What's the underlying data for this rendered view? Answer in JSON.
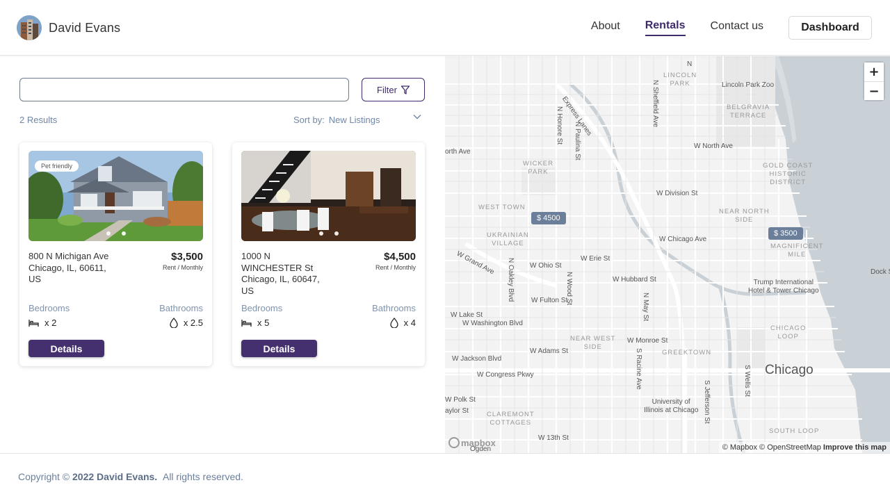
{
  "brand": {
    "name": "David Evans"
  },
  "nav": {
    "items": [
      {
        "label": "About",
        "active": false
      },
      {
        "label": "Rentals",
        "active": true
      },
      {
        "label": "Contact us",
        "active": false
      }
    ],
    "dashboard_label": "Dashboard"
  },
  "search": {
    "value": "",
    "placeholder": ""
  },
  "filter": {
    "label": "Filter",
    "icon": "filter-funnel-icon"
  },
  "results": {
    "text": "2 Results"
  },
  "sort": {
    "label": "Sort by:",
    "value": "New Listings",
    "icon": "chevron-down-icon"
  },
  "listings": [
    {
      "badge": "Pet friendly",
      "address_line1": "800 N Michigan Ave",
      "address_line2": "Chicago, IL, 60611,",
      "address_line3": "US",
      "price": "$3,500",
      "price_period": "Rent / Monthly",
      "bedrooms_label": "Bedrooms",
      "bathrooms_label": "Bathrooms",
      "bedrooms": "x 2",
      "bathrooms": "x 2.5",
      "details_label": "Details"
    },
    {
      "badge": "",
      "address_line1": "1000 N",
      "address_line2": "WINCHESTER St",
      "address_line3": "Chicago, IL, 60647,",
      "address_line4": "US",
      "price": "$4,500",
      "price_period": "Rent / Monthly",
      "bedrooms_label": "Bedrooms",
      "bathrooms_label": "Bathrooms",
      "bedrooms": "x 5",
      "bathrooms": "x 4",
      "details_label": "Details"
    }
  ],
  "map": {
    "markers": [
      "$ 4500",
      "$ 3500"
    ],
    "zoom_in": "+",
    "zoom_out": "−",
    "city_label": "Chicago",
    "logo_text": "mapbox",
    "attribution": "© Mapbox © OpenStreetMap",
    "improve": "Improve this map",
    "labels": {
      "lincoln_park": "LINCOLN\nPARK",
      "lincoln_park_zoo": "Lincoln Park Zoo",
      "belgravia": "BELGRAVIA\nTERRACE",
      "w_north_ave": "W North Ave",
      "wicker_park": "WICKER\nPARK",
      "gold_coast": "GOLD COAST\nHISTORIC\nDISTRICT",
      "w_division": "W Division St",
      "west_town": "WEST TOWN",
      "near_north": "NEAR NORTH\nSIDE",
      "ukrainian": "UKRAINIAN\nVILLAGE",
      "w_chicago_ave": "W Chicago Ave",
      "magnificent": "MAGNIFICENT\nMILE",
      "w_erie": "W Erie St",
      "w_ohio": "W Ohio St",
      "w_grand": "W Grand Ave",
      "w_hubbard": "W Hubbard St",
      "trump": "Trump International\nHotel & Tower Chicago",
      "w_fulton": "W Fulton St",
      "w_lake": "W Lake St",
      "w_washington": "W Washington Blvd",
      "chicago_loop": "CHICAGO\nLOOP",
      "near_west": "NEAR WEST\nSIDE",
      "w_monroe": "W Monroe St",
      "w_adams": "W Adams St",
      "greektown": "GREEKTOWN",
      "w_jackson": "W Jackson Blvd",
      "w_congress": "W Congress Pkwy",
      "w_polk": "W Polk St",
      "taylor": "aylor St",
      "claremont": "CLAREMONT\nCOTTAGES",
      "uic": "University of\nIllinois at Chicago",
      "south_loop": "SOUTH LOOP",
      "w_13th": "W 13th St",
      "orth_ave": "orth Ave",
      "dock_s": "Dock S",
      "express_lanes": "Express Lanes",
      "n_honore": "N Honore St",
      "n_paulina": "N Paulina St",
      "n_sheffield": "N Sheffield Ave",
      "n_oakley": "N Oakley Blvd",
      "n_wood": "N Wood St",
      "n_may": "N May St",
      "s_racine": "S Racine Ave",
      "s_jefferson": "S Jefferson St",
      "s_wells": "S Wells St",
      "n_top": "N",
      "ogden": "Ogden"
    }
  },
  "footer": {
    "prefix": "Copyright ©",
    "year_name": "2022 David Evans.",
    "suffix": "All rights reserved."
  }
}
